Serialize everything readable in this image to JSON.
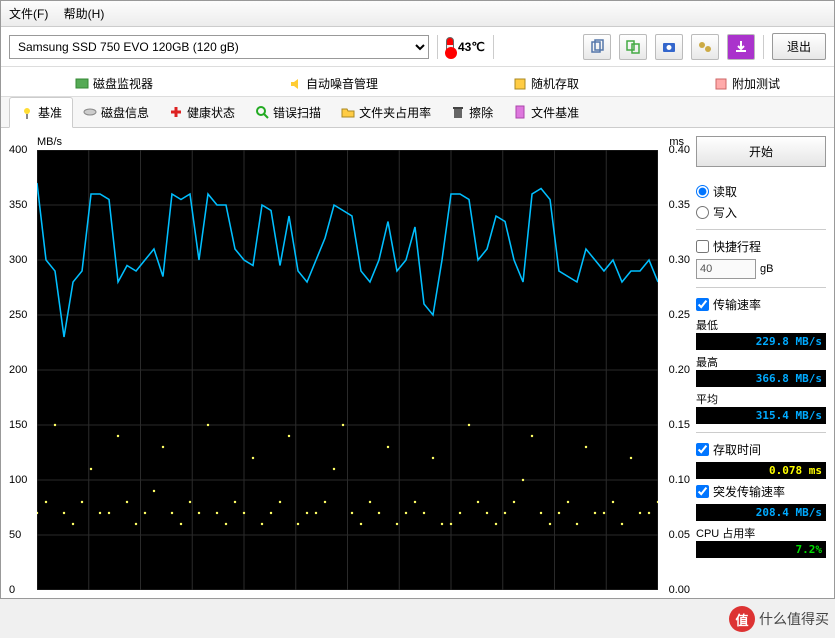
{
  "menu": {
    "file": "文件(F)",
    "help": "帮助(H)"
  },
  "device": "Samsung SSD 750 EVO 120GB (120 gB)",
  "temperature": "43℃",
  "exit": "退出",
  "top_tabs": {
    "disk_monitor": "磁盘监视器",
    "noise_mgmt": "自动噪音管理",
    "random_access": "随机存取",
    "extra_tests": "附加测试"
  },
  "sub_tabs": {
    "benchmark": "基准",
    "disk_info": "磁盘信息",
    "health": "健康状态",
    "error_scan": "错误扫描",
    "folder_usage": "文件夹占用率",
    "erase": "擦除",
    "file_benchmark": "文件基准"
  },
  "chart": {
    "y_label": "MB/s",
    "y2_label": "ms"
  },
  "side": {
    "start": "开始",
    "read": "读取",
    "write": "写入",
    "express": "快捷行程",
    "block_size": "40",
    "block_unit": "gB",
    "transfer_rate": "传输速率",
    "min_label": "最低",
    "min_val": "229.8 MB/s",
    "max_label": "最高",
    "max_val": "366.8 MB/s",
    "avg_label": "平均",
    "avg_val": "315.4 MB/s",
    "access_time": "存取时间",
    "access_val": "0.078 ms",
    "burst_rate": "突发传输速率",
    "burst_val": "208.4 MB/s",
    "cpu_label": "CPU 占用率",
    "cpu_val": "7.2%"
  },
  "watermark": "什么值得买",
  "chart_data": {
    "type": "line+scatter",
    "title": "",
    "xlabel": "",
    "ylabel": "MB/s",
    "y2label": "ms",
    "ylim": [
      0,
      400
    ],
    "y2lim": [
      0,
      0.4
    ],
    "y_ticks": [
      0,
      50,
      100,
      150,
      200,
      250,
      300,
      350,
      400
    ],
    "y2_ticks": [
      0.0,
      0.05,
      0.1,
      0.15,
      0.2,
      0.25,
      0.3,
      0.35,
      0.4
    ],
    "series": [
      {
        "name": "Transfer Rate (MB/s)",
        "axis": "left",
        "color": "#00bfff",
        "values": [
          370,
          300,
          290,
          230,
          280,
          290,
          360,
          360,
          355,
          280,
          295,
          290,
          300,
          310,
          285,
          360,
          355,
          360,
          300,
          360,
          350,
          350,
          310,
          300,
          295,
          350,
          345,
          295,
          340,
          290,
          280,
          300,
          320,
          350,
          345,
          340,
          290,
          280,
          300,
          335,
          290,
          300,
          330,
          260,
          250,
          300,
          360,
          360,
          355,
          300,
          310,
          340,
          335,
          300,
          280,
          360,
          365,
          355,
          290,
          285,
          280,
          310,
          300,
          290,
          300,
          280,
          290,
          290,
          300,
          280
        ]
      },
      {
        "name": "Access Time (ms)",
        "axis": "right",
        "color": "#ffff66",
        "type": "scatter",
        "values": [
          0.07,
          0.08,
          0.15,
          0.07,
          0.06,
          0.08,
          0.11,
          0.07,
          0.07,
          0.14,
          0.08,
          0.06,
          0.07,
          0.09,
          0.13,
          0.07,
          0.06,
          0.08,
          0.07,
          0.15,
          0.07,
          0.06,
          0.08,
          0.07,
          0.12,
          0.06,
          0.07,
          0.08,
          0.14,
          0.06,
          0.07,
          0.07,
          0.08,
          0.11,
          0.15,
          0.07,
          0.06,
          0.08,
          0.07,
          0.13,
          0.06,
          0.07,
          0.08,
          0.07,
          0.12,
          0.06,
          0.06,
          0.07,
          0.15,
          0.08,
          0.07,
          0.06,
          0.07,
          0.08,
          0.1,
          0.14,
          0.07,
          0.06,
          0.07,
          0.08,
          0.06,
          0.13,
          0.07,
          0.07,
          0.08,
          0.06,
          0.12,
          0.07,
          0.07,
          0.08
        ]
      }
    ]
  }
}
